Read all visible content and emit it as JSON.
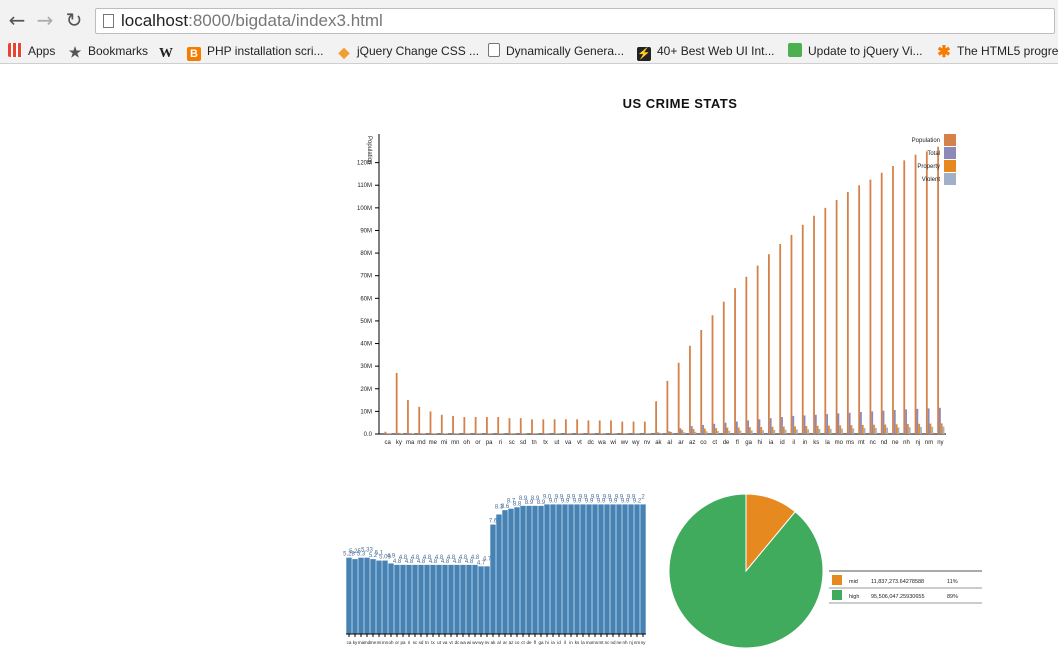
{
  "browser": {
    "url_host": "localhost",
    "url_rest": ":8000/bigdata/index3.html",
    "bookmarks": [
      {
        "label": "Apps",
        "icon": "apps-grid-icon"
      },
      {
        "label": "Bookmarks",
        "icon": "star-icon"
      },
      {
        "label": "",
        "icon": "wikipedia-icon"
      },
      {
        "label": "PHP installation scri...",
        "icon": "blogger-icon"
      },
      {
        "label": "jQuery Change CSS ...",
        "icon": "diamond-icon"
      },
      {
        "label": "Dynamically Genera...",
        "icon": "page-icon"
      },
      {
        "label": "40+ Best Web UI Int...",
        "icon": "bolt-icon"
      },
      {
        "label": "Update to jQuery Vi...",
        "icon": "green-square-icon"
      },
      {
        "label": "The HTML5 progre",
        "icon": "asterisk-icon"
      }
    ]
  },
  "page_title": "US CRIME STATS",
  "chart_data": [
    {
      "type": "bar",
      "ylabel": "Population",
      "ylim": [
        0,
        130000000
      ],
      "yticks": [
        "0.0",
        "10M",
        "20M",
        "30M",
        "40M",
        "50M",
        "60M",
        "70M",
        "80M",
        "90M",
        "100M",
        "110M",
        "120M"
      ],
      "legend_position": "top-right",
      "colors": {
        "Population": "#d4824a",
        "Total": "#8c88b8",
        "Property": "#e6891e",
        "Violent": "#9fb0c8"
      },
      "legend": [
        "Population",
        "Total",
        "Property",
        "Violent"
      ],
      "categories": [
        "ca",
        "ky",
        "ma",
        "md",
        "me",
        "mi",
        "mn",
        "oh",
        "or",
        "pa",
        "ri",
        "sc",
        "sd",
        "tn",
        "tx",
        "ut",
        "va",
        "vt",
        "dc",
        "wa",
        "wi",
        "wv",
        "wy",
        "nv",
        "ak",
        "al",
        "ar",
        "az",
        "co",
        "ct",
        "de",
        "fl",
        "ga",
        "hi",
        "ia",
        "id",
        "il",
        "in",
        "ks",
        "la",
        "mo",
        "ms",
        "mt",
        "nc",
        "nd",
        "ne",
        "nh",
        "nj",
        "nm",
        "ny"
      ],
      "series": [
        {
          "name": "Population",
          "values": [
            1000000,
            27000000,
            15000000,
            12000000,
            10000000,
            8500000,
            8000000,
            7500000,
            7500000,
            7500000,
            7500000,
            7000000,
            7000000,
            6500000,
            6500000,
            6500000,
            6500000,
            6500000,
            6000000,
            6000000,
            6000000,
            5500000,
            5500000,
            5500000,
            14500000,
            23500000,
            31500000,
            39000000,
            46000000,
            52500000,
            58500000,
            64500000,
            69500000,
            74500000,
            79500000,
            84000000,
            88000000,
            92500000,
            96500000,
            100000000,
            103500000,
            107000000,
            110000000,
            112500000,
            115500000,
            118500000,
            121000000,
            123500000,
            125000000,
            127000000
          ]
        },
        {
          "name": "Total",
          "values": [
            300000,
            500000,
            400000,
            350000,
            300000,
            300000,
            280000,
            260000,
            260000,
            250000,
            250000,
            240000,
            240000,
            230000,
            230000,
            220000,
            220000,
            220000,
            210000,
            210000,
            210000,
            200000,
            200000,
            200000,
            700000,
            1200000,
            2500000,
            3500000,
            4000000,
            4500000,
            5000000,
            5500000,
            6000000,
            6500000,
            7000000,
            7500000,
            8000000,
            8200000,
            8500000,
            8800000,
            9100000,
            9400000,
            9700000,
            10000000,
            10300000,
            10600000,
            10900000,
            11100000,
            11300000,
            11600000
          ]
        },
        {
          "name": "Property",
          "values": [
            200000,
            400000,
            300000,
            250000,
            220000,
            220000,
            200000,
            190000,
            190000,
            180000,
            180000,
            170000,
            170000,
            160000,
            160000,
            160000,
            160000,
            160000,
            150000,
            150000,
            150000,
            150000,
            150000,
            150000,
            500000,
            900000,
            1800000,
            2200000,
            2400000,
            2600000,
            2800000,
            2900000,
            3000000,
            3100000,
            3200000,
            3300000,
            3400000,
            3500000,
            3600000,
            3700000,
            3800000,
            3900000,
            4000000,
            4100000,
            4200000,
            4300000,
            4400000,
            4500000,
            4600000,
            4700000
          ]
        },
        {
          "name": "Violent",
          "values": [
            150000,
            200000,
            180000,
            160000,
            150000,
            150000,
            140000,
            140000,
            140000,
            130000,
            130000,
            130000,
            130000,
            120000,
            120000,
            120000,
            120000,
            120000,
            120000,
            120000,
            110000,
            110000,
            110000,
            110000,
            300000,
            500000,
            800000,
            1000000,
            1200000,
            1300000,
            1400000,
            1500000,
            1600000,
            1700000,
            1800000,
            1900000,
            2000000,
            2100000,
            2200000,
            2300000,
            2400000,
            2500000,
            2600000,
            2700000,
            2800000,
            2900000,
            3000000,
            3100000,
            3200000,
            3300000
          ]
        }
      ]
    },
    {
      "type": "bar",
      "ylim": [
        0,
        10
      ],
      "color": "#4682b4",
      "categories": [
        "ca",
        "ky",
        "ma",
        "md",
        "me",
        "mi",
        "mn",
        "oh",
        "or",
        "pa",
        "ri",
        "sc",
        "sd",
        "tn",
        "tx",
        "ut",
        "va",
        "vt",
        "dc",
        "wa",
        "wi",
        "wv",
        "wy",
        "nv",
        "ak",
        "al",
        "ar",
        "az",
        "co",
        "ct",
        "de",
        "fl",
        "ga",
        "hi",
        "ia",
        "id",
        "il",
        "in",
        "ks",
        "la",
        "mo",
        "ms",
        "mt",
        "nc",
        "nd",
        "ne",
        "nh",
        "nj",
        "nm",
        "ny"
      ],
      "values": [
        5.3,
        5.2,
        5.3,
        5.3,
        5.2,
        5.1,
        5.1,
        4.9,
        4.8,
        4.8,
        4.8,
        4.8,
        4.8,
        4.8,
        4.8,
        4.8,
        4.8,
        4.8,
        4.8,
        4.8,
        4.8,
        4.8,
        4.7,
        4.7,
        7.6,
        8.3,
        8.6,
        8.7,
        8.8,
        8.9,
        8.9,
        8.9,
        8.9,
        9.0,
        9.0,
        9.0,
        9.0,
        9.0,
        9.0,
        9.0,
        9.0,
        9.0,
        9.0,
        9.0,
        9.0,
        9.0,
        9.0,
        9.0,
        9.0,
        9.0
      ],
      "data_labels": [
        "5.28",
        "5.25",
        "5.3",
        "5.33",
        "5.2",
        "5.1",
        "5.09",
        "4.9",
        "4.8",
        "4.8",
        "4.8",
        "4.8",
        "4.8",
        "4.8",
        "4.8",
        "4.8",
        "4.8",
        "4.8",
        "4.8",
        "4.8",
        "4.8",
        "4.8",
        "4.7",
        "4.7",
        "7.6",
        "8.3",
        "8.6",
        "8.7",
        "8.8",
        "8.9",
        "8.9",
        "8.9",
        "8.9",
        "9.0",
        "9.0",
        "9.9",
        "9.9",
        "9.9",
        "9.9",
        "9.9",
        "9.9",
        "9.9",
        "9.9",
        "9.9",
        "9.9",
        "9.9",
        "9.9",
        "9.9",
        "9.2",
        "2"
      ]
    },
    {
      "type": "pie",
      "legend_position": "bottom-right",
      "slices": [
        {
          "label": "mid",
          "value": 11837273.64278588,
          "value_text": "11,837,273.64278588",
          "percent": "11%",
          "color": "#e6891e"
        },
        {
          "label": "high",
          "value": 95506047.25930655,
          "value_text": "95,506,047.25930655",
          "percent": "89%",
          "color": "#41ab5d"
        }
      ]
    }
  ]
}
